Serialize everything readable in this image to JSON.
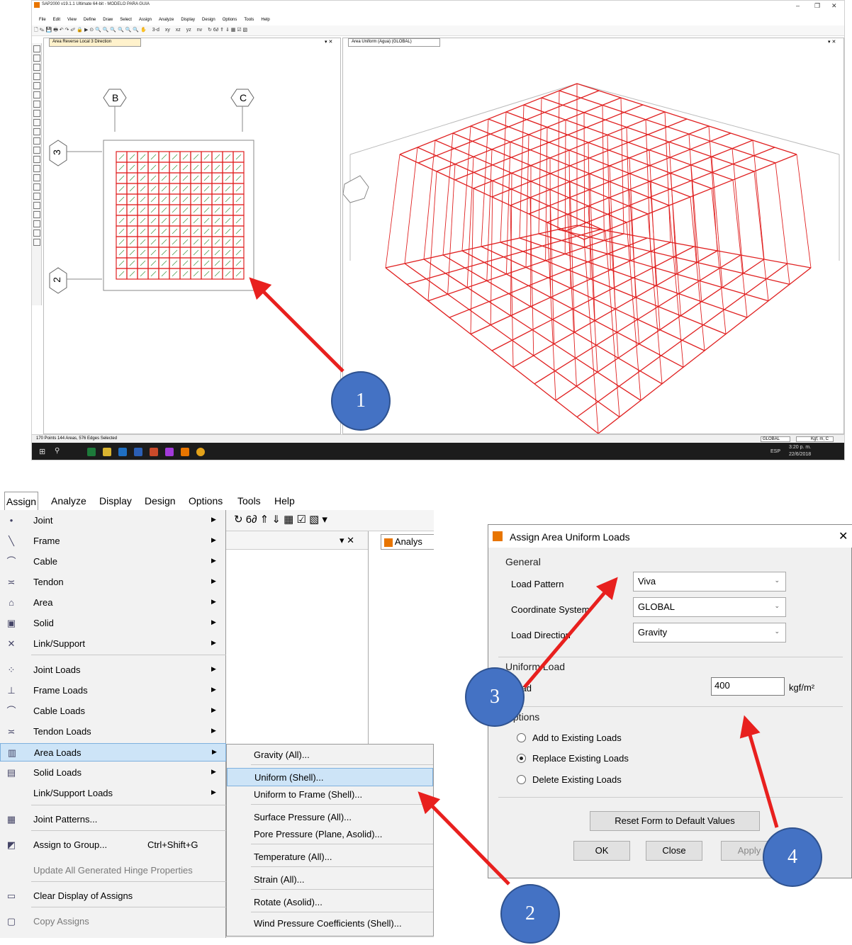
{
  "top": {
    "window_title": "SAP2000 v19.1.1 Ultimate 64-bit - MODELO PARA GUIA",
    "menu": [
      "File",
      "Edit",
      "View",
      "Define",
      "Draw",
      "Select",
      "Assign",
      "Analyze",
      "Display",
      "Design",
      "Options",
      "Tools",
      "Help"
    ],
    "toolbar_text": [
      "3-d",
      "xy",
      "xz",
      "yz",
      "nv"
    ],
    "left_tab": "Area Reverse Local 3 Direction",
    "right_tab": "Area Uniform (Agua) (GLOBAL)",
    "grid_labels": [
      "B",
      "C",
      "3",
      "2"
    ],
    "status": "170 Points  144 Areas, 576 Edges Selected",
    "coord_system": "GLOBAL",
    "units": "Kgf, m, C",
    "clock_time": "3:20 p. m.",
    "clock_date": "22/6/2018",
    "lang": "ESP"
  },
  "menu2": {
    "bar": [
      "Assign",
      "Analyze",
      "Display",
      "Design",
      "Options",
      "Tools",
      "Help"
    ],
    "items": [
      {
        "label": "Joint",
        "icon": "joint-icon",
        "glyph": "•",
        "arrow": true
      },
      {
        "label": "Frame",
        "icon": "frame-icon",
        "glyph": "╲",
        "arrow": true
      },
      {
        "label": "Cable",
        "icon": "cable-icon",
        "glyph": "⌒",
        "arrow": true
      },
      {
        "label": "Tendon",
        "icon": "tendon-icon",
        "glyph": "≍",
        "arrow": true
      },
      {
        "label": "Area",
        "icon": "area-icon",
        "glyph": "⌂",
        "arrow": true
      },
      {
        "label": "Solid",
        "icon": "solid-icon",
        "glyph": "▣",
        "arrow": true
      },
      {
        "label": "Link/Support",
        "icon": "link-icon",
        "glyph": "✕",
        "arrow": true
      },
      {
        "label": "Joint Loads",
        "icon": "joint-loads-icon",
        "glyph": "⁘",
        "arrow": true
      },
      {
        "label": "Frame Loads",
        "icon": "frame-loads-icon",
        "glyph": "⊥",
        "arrow": true
      },
      {
        "label": "Cable Loads",
        "icon": "cable-loads-icon",
        "glyph": "⌒",
        "arrow": true
      },
      {
        "label": "Tendon Loads",
        "icon": "tendon-loads-icon",
        "glyph": "≍",
        "arrow": true
      },
      {
        "label": "Area Loads",
        "icon": "area-loads-icon",
        "glyph": "▥",
        "arrow": true
      },
      {
        "label": "Solid Loads",
        "icon": "solid-loads-icon",
        "glyph": "▤",
        "arrow": true
      },
      {
        "label": "Link/Support Loads",
        "icon": "",
        "glyph": "",
        "arrow": true
      },
      {
        "label": "Joint Patterns...",
        "icon": "joint-patterns-icon",
        "glyph": "▦",
        "arrow": false
      },
      {
        "label": "Assign to Group...",
        "icon": "group-icon",
        "glyph": "◩",
        "arrow": false,
        "shortcut": "Ctrl+Shift+G"
      },
      {
        "label": "Update All Generated Hinge Properties",
        "icon": "",
        "glyph": "",
        "arrow": false
      },
      {
        "label": "Clear Display of Assigns",
        "icon": "clear-icon",
        "glyph": "▭",
        "arrow": false
      },
      {
        "label": "Copy Assigns",
        "icon": "copy-icon",
        "glyph": "▢",
        "arrow": false
      }
    ],
    "pane_tab": "Analys",
    "submenu": [
      "Gravity (All)...",
      "Uniform (Shell)...",
      "Uniform to Frame (Shell)...",
      "Surface Pressure (All)...",
      "Pore Pressure (Plane, Asolid)...",
      "Temperature (All)...",
      "Strain (All)...",
      "Rotate (Asolid)...",
      "Wind Pressure Coefficients (Shell)..."
    ]
  },
  "dialog": {
    "title": "Assign Area Uniform Loads",
    "general": "General",
    "load_pattern_label": "Load Pattern",
    "load_pattern": "Viva",
    "coord_label": "Coordinate System",
    "coord": "GLOBAL",
    "dir_label": "Load Direction",
    "dir": "Gravity",
    "uniform": "Uniform Load",
    "load_label": "Load",
    "load_value": "400",
    "load_unit": "kgf/m²",
    "options": "Options",
    "opt_add": "Add to Existing Loads",
    "opt_replace": "Replace Existing Loads",
    "opt_delete": "Delete Existing Loads",
    "reset": "Reset Form to Default Values",
    "ok": "OK",
    "close": "Close",
    "apply": "Apply"
  },
  "callouts": [
    "1",
    "2",
    "3",
    "4"
  ],
  "colors": {
    "accent_red": "#e8201e",
    "callout_blue": "#4472c4",
    "highlight": "#cde4f7"
  }
}
